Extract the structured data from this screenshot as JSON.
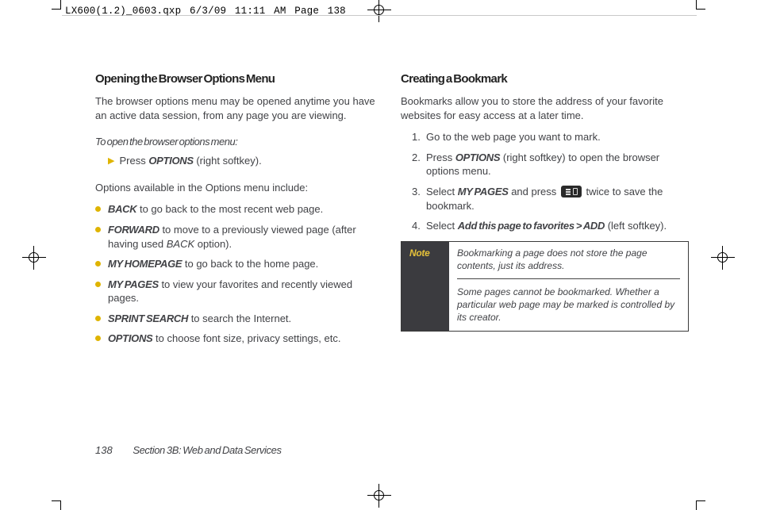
{
  "slug": "LX600(1.2)_0603.qxp  6/3/09  11:11 AM  Page 138",
  "footer": {
    "page_number": "138",
    "section": "Section 3B: Web and Data Services"
  },
  "col1": {
    "heading": "Opening the Browser Options Menu",
    "intro": "The browser options menu may be opened anytime you have an active data session, from any page you are viewing.",
    "instr_lead": "To open the browser options menu:",
    "instr_step_prefix": "Press ",
    "instr_step_kb": "OPTIONS",
    "instr_step_suffix": " (right softkey).",
    "opts_intro": "Options available in the Options menu include:",
    "opts": [
      {
        "kb": "BACK",
        "after": " to go back to the most recent web page."
      },
      {
        "kb": "FORWARD",
        "after": "  to move to a previously viewed page (after having used ",
        "ki": "BACK",
        "tail": " option)."
      },
      {
        "kb": "MY HOMEPAGE",
        "after": "  to go back to the home page."
      },
      {
        "kb": "MY PAGES",
        "after": "  to view your favorites and recently viewed pages."
      },
      {
        "kb": "SPRINT SEARCH",
        "after": "  to search the Internet."
      },
      {
        "kb": "OPTIONS",
        "after": "   to choose font size, privacy settings, etc."
      }
    ]
  },
  "col2": {
    "heading": "Creating a Bookmark",
    "intro": "Bookmarks allow you to store the address of your favorite websites for easy access at a later time.",
    "steps": [
      {
        "n": "1.",
        "pre": "Go to the web page you want to mark."
      },
      {
        "n": "2.",
        "pre": "Press ",
        "kb": "OPTIONS",
        "post": " (right softkey) to open the browser options menu."
      },
      {
        "n": "3.",
        "pre": "Select ",
        "kb": "MY PAGES",
        "mid": " and press ",
        "icon": true,
        "post2": " twice to save the bookmark."
      },
      {
        "n": "4.",
        "pre": "Select ",
        "kb": "Add this page to favorites > ADD",
        "post": " (left softkey)."
      }
    ],
    "note_label": "Note",
    "note_p1": "Bookmarking a page does not store the page contents, just its address.",
    "note_p2": "Some pages cannot be bookmarked. Whether a particular web page may be marked is controlled by its creator."
  }
}
